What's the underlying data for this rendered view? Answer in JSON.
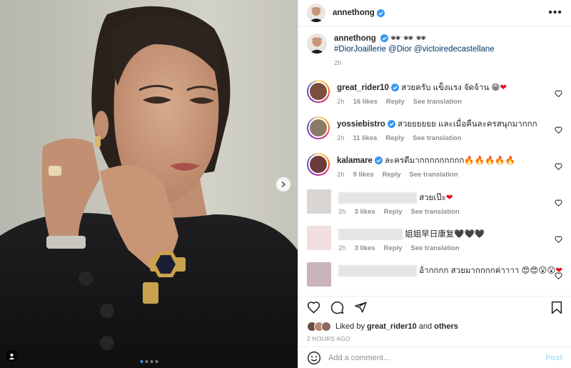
{
  "post": {
    "author": "annethong",
    "verified": true
  },
  "caption": {
    "username": "annethong",
    "emojis": "🕶 🕶 🕶",
    "tags": "#DiorJoaillerie @Dior @victoiredecastellane",
    "time": "2h"
  },
  "comments": [
    {
      "username": "great_rider10",
      "verified": true,
      "text": "สวยครับ แข็งแรง จัดจ้าน 😁",
      "heart": "❤",
      "time": "2h",
      "likes": "16 likes",
      "reply": "Reply",
      "translate": "See translation",
      "avatar_color": "#7a4f3c"
    },
    {
      "username": "yossiebistro",
      "verified": true,
      "text": "สวยยยยยย และเมื่อคืนละครสนุกมากกก",
      "heart": "",
      "time": "2h",
      "likes": "11 likes",
      "reply": "Reply",
      "translate": "See translation",
      "avatar_color": "#8a7a66"
    },
    {
      "username": "kalamare",
      "verified": true,
      "text": "ละครดีมากกกกกกกกก🔥🔥🔥🔥🔥",
      "heart": "",
      "time": "2h",
      "likes": "9 likes",
      "reply": "Reply",
      "translate": "See translation",
      "avatar_color": "#6e3b3b"
    },
    {
      "username": "",
      "verified": false,
      "text": "สวยเป๊ะ",
      "heart": "❤",
      "time": "2h",
      "likes": "3 likes",
      "reply": "Reply",
      "translate": "See translation",
      "avatar_color": "#d9d5d3"
    },
    {
      "username": "",
      "verified": false,
      "text": "姐姐早日康复🖤🖤🖤",
      "heart": "",
      "time": "2h",
      "likes": "3 likes",
      "reply": "Reply",
      "translate": "See translation",
      "avatar_color": "#f1dede"
    },
    {
      "username": "",
      "verified": false,
      "text": "อ้ากกกก สวยมากกกกค่าาาา 😍😍😮😮",
      "heart": "❤",
      "time": "",
      "likes": "",
      "reply": "",
      "translate": "",
      "avatar_color": "#c9b3bd"
    }
  ],
  "likes": {
    "prefix": "Liked by ",
    "user": "great_rider10",
    "middle": " and ",
    "others": "others"
  },
  "timestamp": "2 HOURS AGO",
  "composer": {
    "placeholder": "Add a comment...",
    "post_label": "Post"
  },
  "carousel": {
    "total": 4,
    "active": 0
  },
  "colors": {
    "verified": "#3897f0",
    "link": "#00376b",
    "heart": "#e2141f",
    "muted": "#8e8e8e"
  }
}
